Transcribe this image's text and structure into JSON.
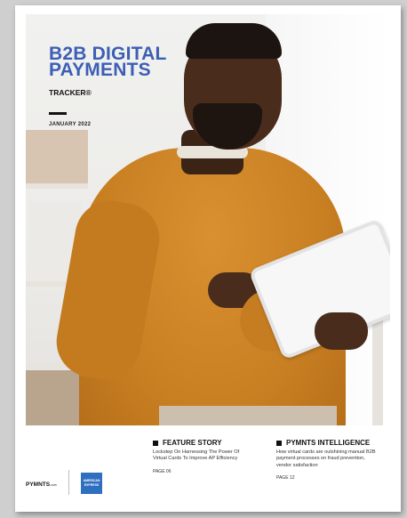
{
  "cover": {
    "title_line1": "B2B DIGITAL",
    "title_line2": "PAYMENTS",
    "subtitle": "TRACKER®",
    "date": "JANUARY 2022",
    "brand_color": "#3c5fb5"
  },
  "feature": {
    "heading": "FEATURE STORY",
    "text": "Lockstep On Harnessing The Power Of Virtual Cards To Improve AP Efficiency",
    "page": "PAGE 06"
  },
  "intelligence": {
    "heading": "PYMNTS INTELLIGENCE",
    "text": "How virtual cards are outshining manual B2B payment processes on fraud prevention, vendor satisfaction",
    "page": "PAGE 12"
  },
  "logos": {
    "pymnts": "PYMNTS",
    "pymnts_suffix": ".com",
    "amex_line1": "AMERICAN",
    "amex_line2": "EXPRESS"
  },
  "photo": {
    "icon": "man-with-tablet-photo"
  }
}
